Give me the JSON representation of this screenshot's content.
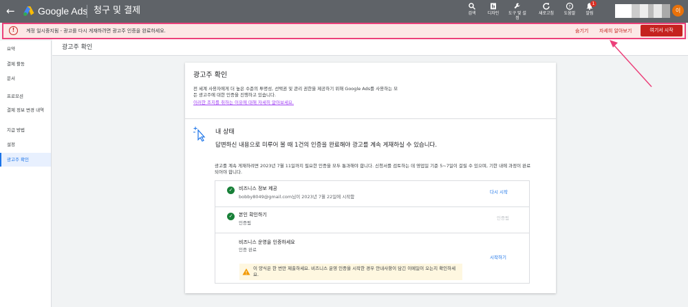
{
  "topbar": {
    "brand": "Google Ads",
    "heading": "청구 및 결제",
    "tools": [
      {
        "icon": "search-icon",
        "label": "검색"
      },
      {
        "icon": "reports-icon",
        "label": "디자인"
      },
      {
        "icon": "tools-icon",
        "label": "도구 및 설정"
      },
      {
        "icon": "refresh-icon",
        "label": "새로고침"
      },
      {
        "icon": "help-icon",
        "label": "도움말"
      },
      {
        "icon": "bell-icon",
        "label": "알림"
      }
    ],
    "notification_count": "1",
    "avatar_initial": "이"
  },
  "alert": {
    "text": "계정 일시중지됨 - 광고를 다시 게재하려면 광고주 인증을 완료하세요.",
    "hide": "숨기기",
    "learn_more": "자세히 알아보기",
    "start": "여기서 시작"
  },
  "sidebar": {
    "items": [
      {
        "label": "요약"
      },
      {
        "label": "결제 활동"
      },
      {
        "label": "문서"
      },
      {
        "label": "프로모션"
      },
      {
        "label": "결제 정보 변경 내역"
      },
      {
        "label": "지급 방법"
      },
      {
        "label": "설정"
      },
      {
        "label": "광고주 확인"
      }
    ]
  },
  "content": {
    "title": "광고주 확인"
  },
  "card": {
    "title": "광고주 확인",
    "description": "전 세계 사용자에게 더 높은 수준의 투명성, 선택권 및 관리 권한을 제공하기 위해 Google Ads를 사용하는 모든 광고주에 대한 인증을 진행하고 있습니다.",
    "link": "이러한 조치를 취하는 이유에 대해 자세히 알아보세요.",
    "status_title": "내 상태",
    "status_subtitle": "답변하신 내용으로 미루어 볼 때 1건의 인증을 완료해야 광고를 계속 게재하실 수 있습니다.",
    "status_info": "광고를 계속 게재하려면 2023년 7월 11일까지 필요한 인증을 모두 통과해야 합니다. 신청서를 검토하는 데 영업일 기준 5~7일이 걸릴 수 있으며, 기한 내에 과정이 완료되어야 합니다.",
    "steps": [
      {
        "title": "비즈니스 정보 제공",
        "subtitle": "bobby8049@gmail.com님이 2023년 7월 22일에 시작함",
        "action": "다시 시작"
      },
      {
        "title": "본인 확인하기",
        "subtitle": "인증됨",
        "action": "인증됨"
      },
      {
        "title": "비즈니스 운영을 인증하세요",
        "subtitle": "인증 완료",
        "action": "시작하기",
        "warning": "이 양식은 한 번만 제출하세요. 비즈니스 운영 인증을 시작한 경우 안내사항이 담긴 이메일이 오는지 확인하세요."
      }
    ]
  },
  "colors": {
    "topbar": "#5f6368",
    "alert_bg": "#fce8e6",
    "alert_border": "#ec407a",
    "primary_red": "#c5221f",
    "link_blue": "#1a73e8",
    "success_green": "#188038"
  }
}
